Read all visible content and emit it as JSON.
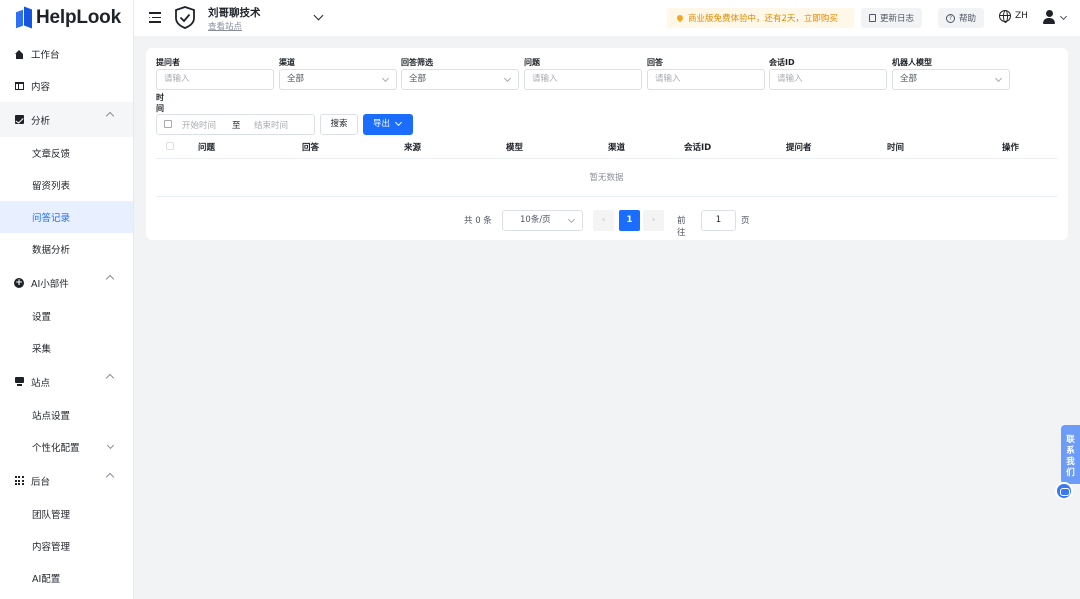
{
  "brand": {
    "name": "HelpLook"
  },
  "sidebar": {
    "items": [
      {
        "label": "工作台",
        "icon": "home-icon"
      },
      {
        "label": "内容",
        "icon": "book-icon"
      },
      {
        "label": "分析",
        "icon": "chart-icon",
        "children": [
          "文章反馈",
          "留资列表",
          "问答记录",
          "数据分析"
        ]
      },
      {
        "label": "AI小部件",
        "icon": "plus-circle-icon",
        "children": [
          "设置",
          "采集"
        ]
      },
      {
        "label": "站点",
        "icon": "monitor-icon",
        "children": [
          "站点设置",
          "个性化配置"
        ]
      },
      {
        "label": "后台",
        "icon": "grid-icon",
        "children": [
          "团队管理",
          "内容管理",
          "AI配置"
        ]
      }
    ],
    "active": "问答记录"
  },
  "header": {
    "site_name": "刘哥聊技术",
    "site_link": "查看站点",
    "promo": "商业版免费体验中，还有2天，立即购买",
    "changelog": "更新日志",
    "help": "帮助",
    "lang": "ZH"
  },
  "filters": {
    "asker": {
      "label": "提问者",
      "placeholder": "请输入"
    },
    "channel": {
      "label": "渠道",
      "value": "全部"
    },
    "answer_filter": {
      "label": "回答筛选",
      "value": "全部"
    },
    "question": {
      "label": "问题",
      "placeholder": "请输入"
    },
    "answer": {
      "label": "回答",
      "placeholder": "请输入"
    },
    "session_id": {
      "label": "会话ID",
      "placeholder": "请输入"
    },
    "bot_model": {
      "label": "机器人模型",
      "value": "全部"
    },
    "time": {
      "label": "时间",
      "start": "开始时间",
      "sep": "至",
      "end": "结束时间"
    },
    "search_label": "搜索",
    "export_label": "导出"
  },
  "table": {
    "columns": [
      "问题",
      "回答",
      "来源",
      "模型",
      "渠道",
      "会话ID",
      "提问者",
      "时间",
      "操作"
    ],
    "empty_text": "暂无数据"
  },
  "pagination": {
    "total": "共 0 条",
    "page_size": "10条/页",
    "current": "1",
    "goto_label": "前往",
    "goto_value": "1",
    "page_unit": "页"
  },
  "contact": {
    "chars": [
      "联",
      "系",
      "我",
      "们"
    ]
  }
}
